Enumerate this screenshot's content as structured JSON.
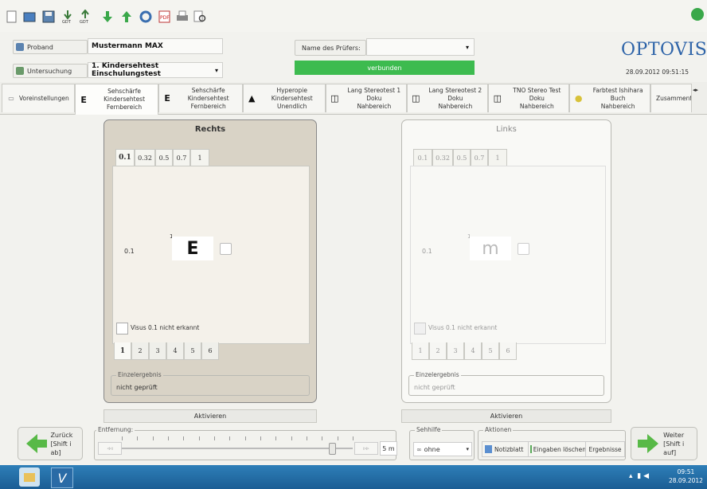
{
  "toolbar": {
    "icons": [
      "new-file",
      "open-folder",
      "save",
      "download-gdt",
      "upload-gdt",
      "arrow-down",
      "arrow-up",
      "refresh",
      "pdf",
      "print",
      "preview"
    ]
  },
  "header": {
    "patient_label": "Proband",
    "patient_name": "Mustermann MAX",
    "exam_label": "Untersuchung",
    "exam_value": "1. Kindersehtest Einschulungstest",
    "examiner_label": "Name des Prüfers:",
    "examiner_value": "",
    "connection_status": "verbunden",
    "logo_text": "OPTOVIST",
    "datetime": "28.09.2012  09:51:15"
  },
  "tabs": [
    {
      "icon": "E",
      "line1": "",
      "line2": "Voreinstellungen"
    },
    {
      "icon": "E",
      "line1": "Sehschärfe Kindersehtest",
      "line2": "Fernbereich"
    },
    {
      "icon": "E",
      "line1": "Sehschärfe Kindersehtest",
      "line2": "Fernbereich"
    },
    {
      "icon": "▲",
      "line1": "Hyperopie Kindersehtest",
      "line2": "Unendlich"
    },
    {
      "icon": "◫",
      "line1": "Lang Stereotest 1 Doku",
      "line2": "Nahbereich"
    },
    {
      "icon": "◫",
      "line1": "Lang Stereotest 2 Doku",
      "line2": "Nahbereich"
    },
    {
      "icon": "◫",
      "line1": "TNO Stereo Test Doku",
      "line2": "Nahbereich"
    },
    {
      "icon": "●",
      "line1": "Farbtest Ishihara Buch",
      "line2": "Nahbereich"
    },
    {
      "icon": "",
      "line1": "",
      "line2": "Zusammenfas"
    }
  ],
  "right_eye": {
    "title": "Rechts",
    "visus_tabs": [
      "0.1",
      "0.32",
      "0.5",
      "0.7",
      "1"
    ],
    "row_label": "0.1",
    "optotype": "E",
    "superscript": "1",
    "checkbox_label": "Visus 0.1 nicht erkannt",
    "number_tabs": [
      "1",
      "2",
      "3",
      "4",
      "5",
      "6"
    ],
    "result_legend": "Einzelergebnis",
    "result_value": "nicht geprüft",
    "activate_label": "Aktivieren"
  },
  "left_eye": {
    "title": "Links",
    "visus_tabs": [
      "0.1",
      "0.32",
      "0.5",
      "0.7",
      "1"
    ],
    "row_label": "0.1",
    "optotype": "m",
    "superscript": "1",
    "checkbox_label": "Visus 0.1 nicht erkannt",
    "number_tabs": [
      "1",
      "2",
      "3",
      "4",
      "5",
      "6"
    ],
    "result_legend": "Einzelergebnis",
    "result_value": "nicht geprüft",
    "activate_label": "Aktivieren"
  },
  "bottom": {
    "back_label": "Zurück",
    "back_shortcut": "[Shift i ab]",
    "distance_legend": "Entfernung:",
    "distance_value": "5",
    "distance_unit": "m",
    "distance_slider_fraction": 0.91,
    "sehhilfe_legend": "Sehhilfe",
    "sehhilfe_value": "ohne",
    "aktionen_legend": "Aktionen",
    "notizblatt": "Notizblatt",
    "eingaben_loeschen": "Eingaben löschen",
    "ergebnisse": "Ergebnisse",
    "next_label": "Weiter",
    "next_shortcut": "[Shift i auf]"
  },
  "taskbar": {
    "time": "09:51",
    "date": "28.09.2012"
  },
  "colors": {
    "accent_green": "#3aa84a",
    "logo_blue": "#2d63a8",
    "connected_green": "#3dbb4f",
    "taskbar_blue": "#1b5d94"
  }
}
